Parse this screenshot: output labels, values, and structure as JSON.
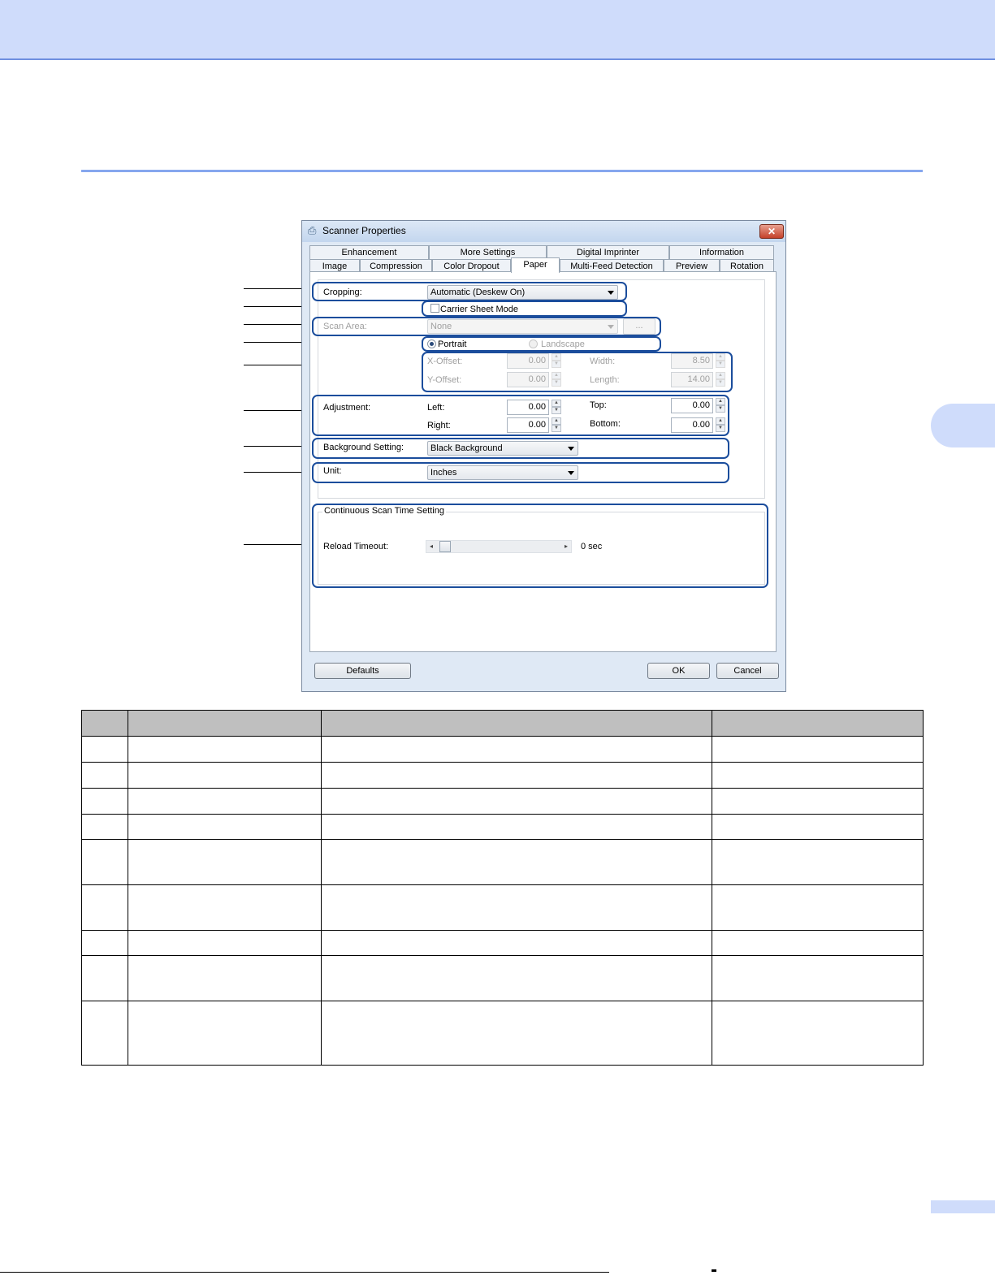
{
  "dialog": {
    "title": "Scanner Properties",
    "close_label": "✕",
    "tabs_row1": [
      "Enhancement",
      "More Settings",
      "Digital Imprinter",
      "Information"
    ],
    "tabs_row2": [
      "Image",
      "Compression",
      "Color Dropout",
      "Paper",
      "Multi-Feed Detection",
      "Preview",
      "Rotation"
    ],
    "active_tab": "Paper",
    "cropping": {
      "label": "Cropping:",
      "value": "Automatic (Deskew On)"
    },
    "carrier_sheet": {
      "label": "Carrier Sheet Mode",
      "checked": false
    },
    "scan_area": {
      "label": "Scan Area:",
      "value": "None",
      "button": "..."
    },
    "orientation": {
      "portrait": "Portrait",
      "landscape": "Landscape",
      "selected": "Portrait"
    },
    "offsets": {
      "x_label": "X-Offset:",
      "x_value": "0.00",
      "y_label": "Y-Offset:",
      "y_value": "0.00",
      "width_label": "Width:",
      "width_value": "8.50",
      "length_label": "Length:",
      "length_value": "14.00"
    },
    "adjustment": {
      "label": "Adjustment:",
      "left_label": "Left:",
      "left_value": "0.00",
      "right_label": "Right:",
      "right_value": "0.00",
      "top_label": "Top:",
      "top_value": "0.00",
      "bottom_label": "Bottom:",
      "bottom_value": "0.00"
    },
    "background": {
      "label": "Background Setting:",
      "value": "Black Background"
    },
    "unit": {
      "label": "Unit:",
      "value": "Inches"
    },
    "continuous_scan": {
      "group_title": "Continuous Scan Time Setting",
      "reload_label": "Reload Timeout:",
      "reload_value": "0 sec",
      "slider_position": 0
    },
    "buttons": {
      "defaults": "Defaults",
      "ok": "OK",
      "cancel": "Cancel"
    }
  },
  "reference_table": {
    "rows": 9
  }
}
